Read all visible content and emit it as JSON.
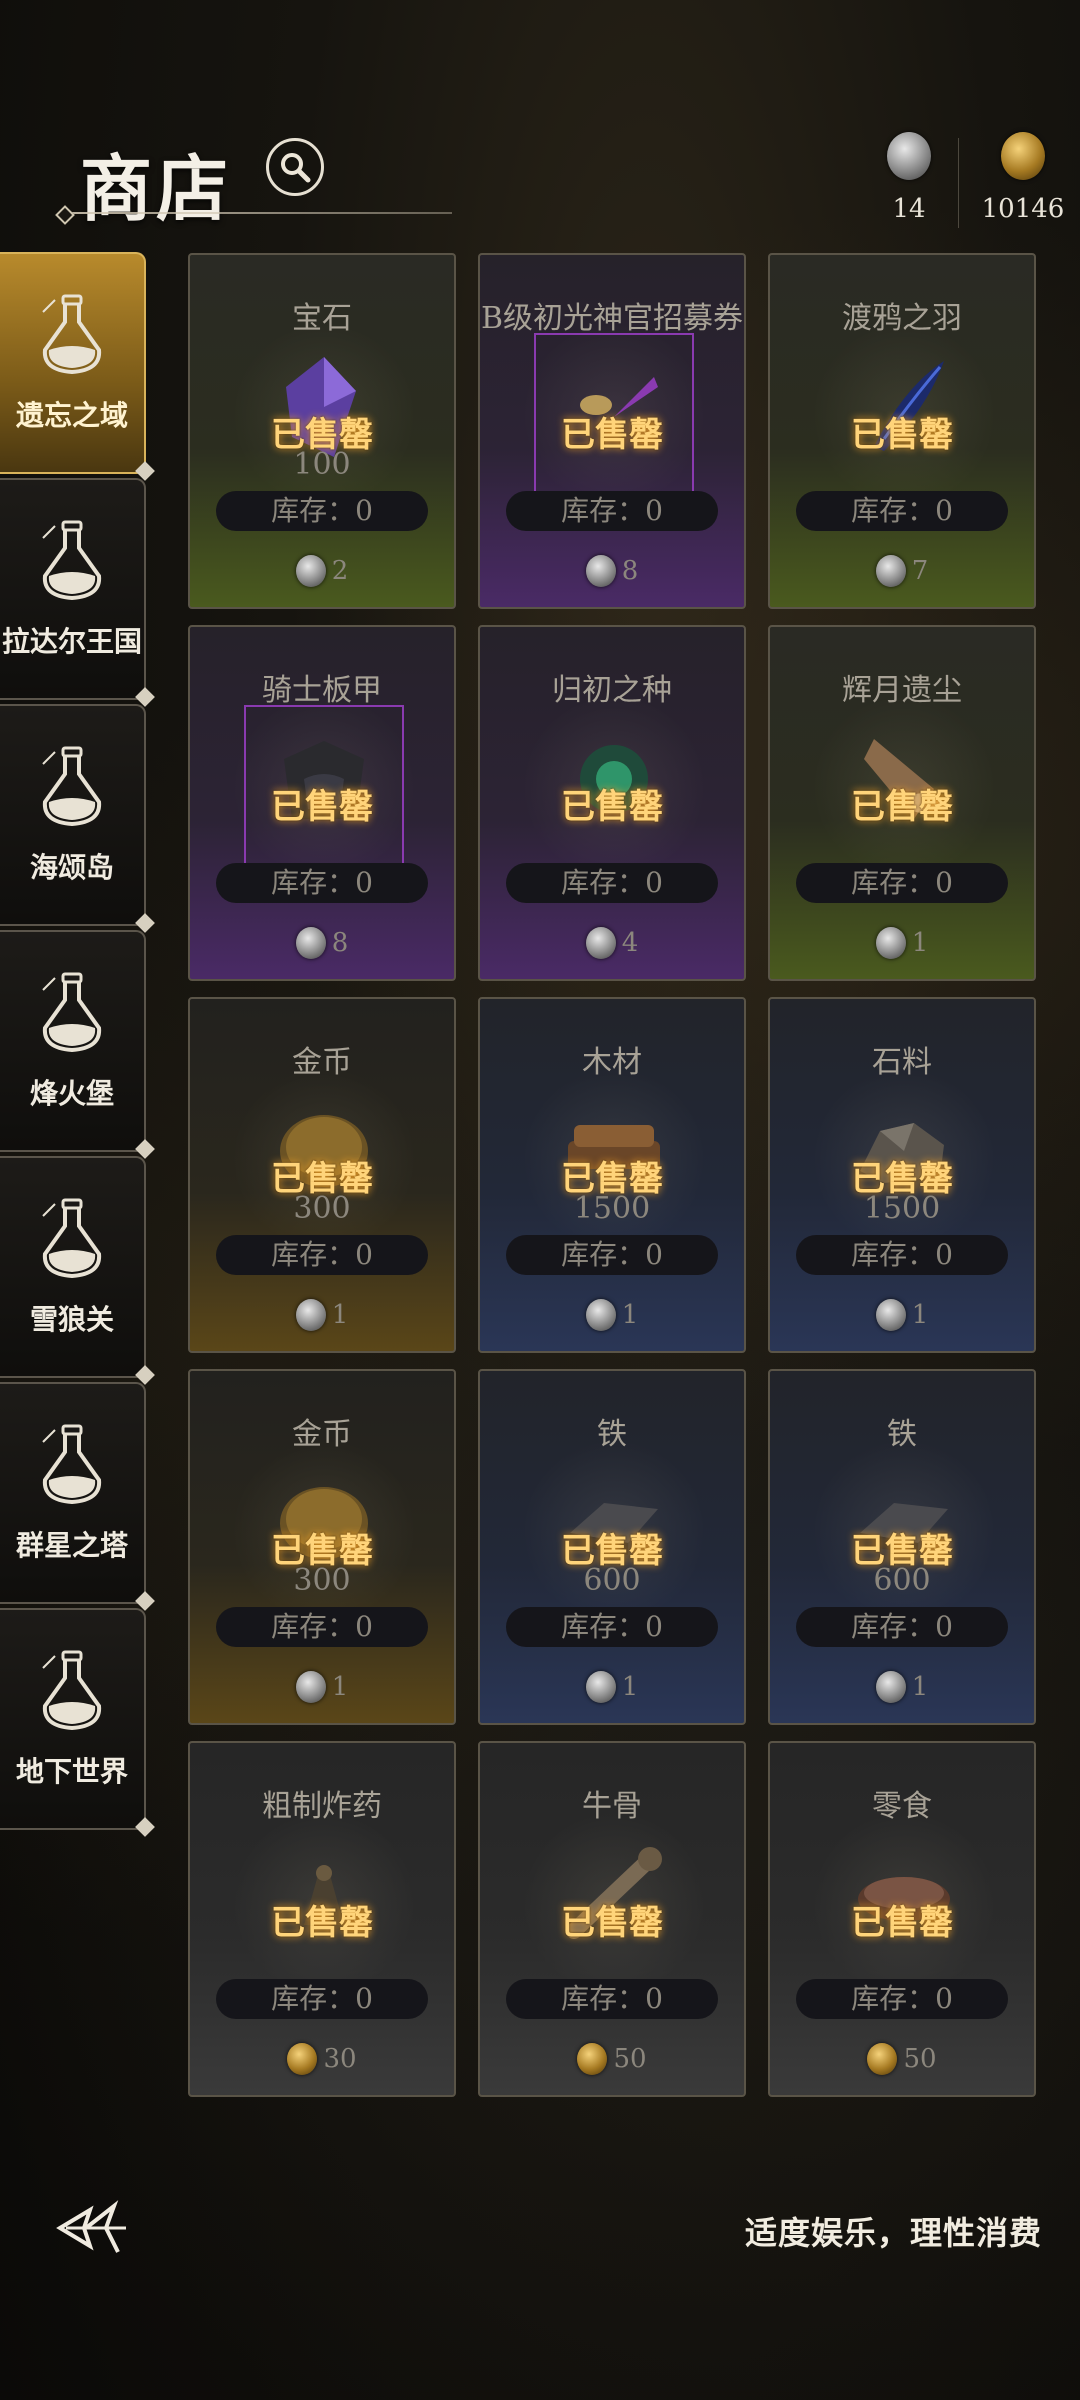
{
  "header": {
    "title": "商店",
    "currencies": [
      {
        "icon": "silver-coin-icon",
        "value": "14"
      },
      {
        "icon": "gold-coin-icon",
        "value": "10146"
      }
    ]
  },
  "sidebar": {
    "items": [
      {
        "label": "遗忘之域",
        "active": true
      },
      {
        "label": "拉达尔王国",
        "active": false
      },
      {
        "label": "海颂岛",
        "active": false
      },
      {
        "label": "烽火堡",
        "active": false
      },
      {
        "label": "雪狼关",
        "active": false
      },
      {
        "label": "群星之塔",
        "active": false
      },
      {
        "label": "地下世界",
        "active": false
      }
    ]
  },
  "shop": {
    "sold_label": "已售罄",
    "items": [
      {
        "name": "宝石",
        "qty": "100",
        "stock": "库存：0",
        "price": "2",
        "currency": "silver",
        "rarity": "green",
        "icon": "gem-icon"
      },
      {
        "name": "B级初光神官招募券",
        "qty": "",
        "stock": "库存：0",
        "price": "8",
        "currency": "silver",
        "rarity": "purple",
        "icon": "ticket-icon"
      },
      {
        "name": "渡鸦之羽",
        "qty": "",
        "stock": "库存：0",
        "price": "7",
        "currency": "silver",
        "rarity": "green",
        "icon": "feather-icon"
      },
      {
        "name": "骑士板甲",
        "qty": "",
        "stock": "库存：0",
        "price": "8",
        "currency": "silver",
        "rarity": "purple",
        "icon": "armor-icon"
      },
      {
        "name": "归初之种",
        "qty": "",
        "stock": "库存：0",
        "price": "4",
        "currency": "silver",
        "rarity": "purple",
        "icon": "seed-icon"
      },
      {
        "name": "辉月遗尘",
        "qty": "",
        "stock": "库存：0",
        "price": "1",
        "currency": "silver",
        "rarity": "green",
        "icon": "dust-icon"
      },
      {
        "name": "金币",
        "qty": "300",
        "stock": "库存：0",
        "price": "1",
        "currency": "silver",
        "rarity": "gold",
        "icon": "gold-coin-icon"
      },
      {
        "name": "木材",
        "qty": "1500",
        "stock": "库存：0",
        "price": "1",
        "currency": "silver",
        "rarity": "blue",
        "icon": "wood-icon"
      },
      {
        "name": "石料",
        "qty": "1500",
        "stock": "库存：0",
        "price": "1",
        "currency": "silver",
        "rarity": "blue",
        "icon": "stone-icon"
      },
      {
        "name": "金币",
        "qty": "300",
        "stock": "库存：0",
        "price": "1",
        "currency": "silver",
        "rarity": "gold",
        "icon": "gold-coin-icon"
      },
      {
        "name": "铁",
        "qty": "600",
        "stock": "库存：0",
        "price": "1",
        "currency": "silver",
        "rarity": "blue",
        "icon": "iron-icon"
      },
      {
        "name": "铁",
        "qty": "600",
        "stock": "库存：0",
        "price": "1",
        "currency": "silver",
        "rarity": "blue",
        "icon": "iron-icon"
      },
      {
        "name": "粗制炸药",
        "qty": "",
        "stock": "库存：0",
        "price": "30",
        "currency": "gold",
        "rarity": "gray",
        "icon": "bomb-icon"
      },
      {
        "name": "牛骨",
        "qty": "",
        "stock": "库存：0",
        "price": "50",
        "currency": "gold",
        "rarity": "gray",
        "icon": "bone-icon"
      },
      {
        "name": "零食",
        "qty": "",
        "stock": "库存：0",
        "price": "50",
        "currency": "gold",
        "rarity": "gray",
        "icon": "snack-icon"
      }
    ]
  },
  "footer": {
    "logo": "game-logo-icon",
    "slogan": "适度娱乐，理性消费"
  }
}
